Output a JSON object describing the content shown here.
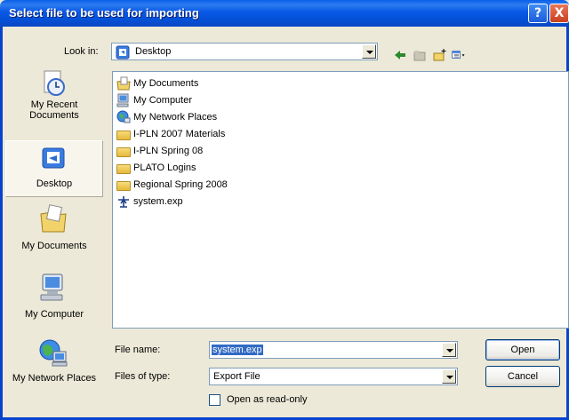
{
  "window": {
    "title": "Select file to be used for importing",
    "help_label": "?",
    "close_label": "X"
  },
  "look_in": {
    "label": "Look in:",
    "value": "Desktop"
  },
  "places": [
    {
      "label": "My Recent Documents"
    },
    {
      "label": "Desktop"
    },
    {
      "label": "My Documents"
    },
    {
      "label": "My Computer"
    },
    {
      "label": "My Network Places"
    }
  ],
  "files": [
    {
      "name": "My Documents",
      "icon": "my-documents-icon"
    },
    {
      "name": "My Computer",
      "icon": "my-computer-icon"
    },
    {
      "name": "My Network Places",
      "icon": "network-places-icon"
    },
    {
      "name": "I-PLN 2007 Materials",
      "icon": "folder-icon"
    },
    {
      "name": "I-PLN Spring 08",
      "icon": "folder-icon"
    },
    {
      "name": "PLATO Logins",
      "icon": "folder-icon"
    },
    {
      "name": "Regional Spring 2008",
      "icon": "folder-icon"
    },
    {
      "name": "system.exp",
      "icon": "exp-file-icon"
    }
  ],
  "file_name": {
    "label": "File name:",
    "value": "system.exp"
  },
  "file_type": {
    "label": "Files of type:",
    "value": "Export File"
  },
  "read_only": {
    "label": "Open as read-only",
    "checked": false
  },
  "buttons": {
    "open": "Open",
    "cancel": "Cancel"
  },
  "colors": {
    "titlebar": "#0A5FE8",
    "selection": "#316AC5",
    "dialog_bg": "#ECE9D8"
  }
}
